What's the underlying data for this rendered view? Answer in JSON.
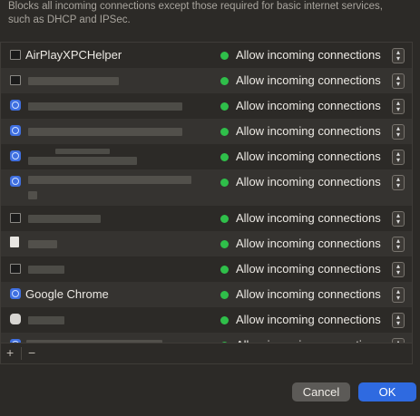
{
  "description": "Blocks all incoming connections except those required for basic internet services, such as DHCP and IPSec.",
  "status_label": "Allow incoming connections",
  "rows": [
    {
      "name": "AirPlayXPCHelper",
      "icon": "terminal-icon"
    },
    {
      "name": "",
      "icon": "terminal-icon"
    },
    {
      "name": "",
      "icon": "globe-app-icon"
    },
    {
      "name": "",
      "icon": "globe-app-icon"
    },
    {
      "name": "",
      "icon": "globe-app-icon"
    },
    {
      "name": "",
      "icon": "globe-app-icon"
    },
    {
      "name": "",
      "icon": "terminal-icon"
    },
    {
      "name": "",
      "icon": "document-icon"
    },
    {
      "name": "",
      "icon": "terminal-icon"
    },
    {
      "name": "Google Chrome",
      "icon": "globe-app-icon"
    },
    {
      "name": "",
      "icon": "generic-app-icon"
    },
    {
      "name": "",
      "icon": "globe-app-icon"
    }
  ],
  "footer": {
    "add": "+",
    "remove": "−"
  },
  "buttons": {
    "cancel": "Cancel",
    "ok": "OK"
  },
  "colors": {
    "allow_dot": "#2fbf4a",
    "ok_button": "#2f6ae0"
  }
}
